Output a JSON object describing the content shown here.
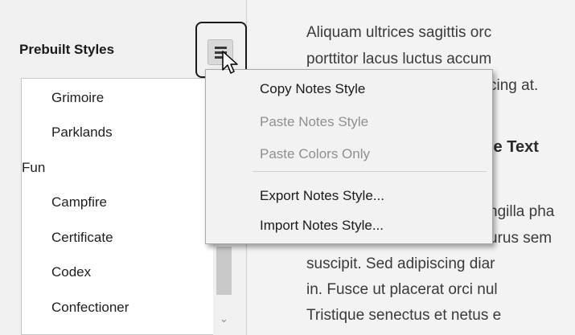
{
  "left_panel": {
    "title": "Prebuilt Styles",
    "menu_button_icon": "hamburger-menu-icon",
    "items": [
      {
        "label": "Grimoire",
        "kind": "child"
      },
      {
        "label": "Parklands",
        "kind": "child"
      },
      {
        "label": "Fun",
        "kind": "group"
      },
      {
        "label": "Campfire",
        "kind": "child"
      },
      {
        "label": "Certificate",
        "kind": "child"
      },
      {
        "label": "Codex",
        "kind": "child"
      },
      {
        "label": "Confectioner",
        "kind": "child"
      }
    ]
  },
  "context_menu": {
    "items": [
      {
        "label": "Copy Notes Style",
        "enabled": true
      },
      {
        "label": "Paste Notes Style",
        "enabled": false
      },
      {
        "label": "Paste Colors Only",
        "enabled": false
      },
      {
        "label": "Export Notes Style...",
        "enabled": true
      },
      {
        "label": "Import Notes Style...",
        "enabled": true
      }
    ]
  },
  "preview": {
    "lines": [
      "Aliquam ultrices sagittis orc",
      "porttitor lacus luctus accum",
      "cing at.",
      "le Text",
      "ngilla pha",
      "urus sem",
      "suscipit. Sed adipiscing diar",
      "in. Fusce ut placerat orci nul",
      "Tristique senectus et netus e"
    ]
  },
  "colors": {
    "panel_bg": "#f0f0f0",
    "list_bg": "#ffffff",
    "menu_bg": "#f2f2f2",
    "disabled_text": "#8f8f8f"
  }
}
